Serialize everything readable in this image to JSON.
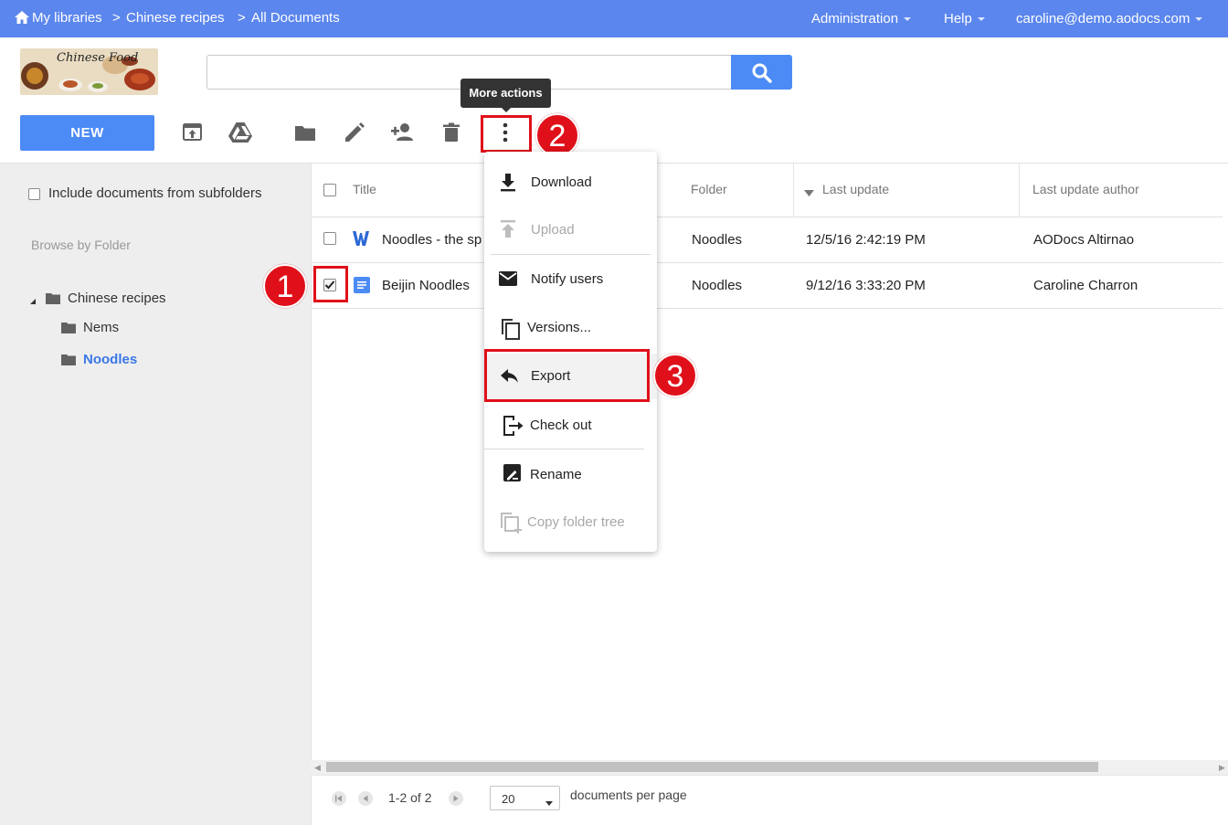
{
  "topbar": {
    "home_label": "My libraries",
    "crumb_sep": ">",
    "crumb_library": "Chinese recipes",
    "crumb_view": "All Documents",
    "admin_label": "Administration",
    "help_label": "Help",
    "user_email": "caroline@demo.aodocs.com"
  },
  "header": {
    "logo_text": "Chinese Food",
    "search_placeholder": ""
  },
  "toolbar": {
    "new_label": "NEW",
    "tooltip": "More actions"
  },
  "sidebar": {
    "include_subfolders_label": "Include documents from subfolders",
    "browse_label": "Browse by Folder",
    "tree_root": "Chinese recipes",
    "tree_children": [
      "Nems",
      "Noodles"
    ]
  },
  "table": {
    "headers": {
      "title": "Title",
      "folder": "Folder",
      "last_update": "Last update",
      "last_update_author": "Last update author"
    },
    "rows": [
      {
        "title": "Noodles - the sp",
        "folder": "Noodles",
        "last_update": "12/5/16 2:42:19 PM",
        "author": "AODocs Altirnao",
        "checked": false,
        "type": "word-doc"
      },
      {
        "title": "Beijin Noodles",
        "folder": "Noodles",
        "last_update": "9/12/16 3:33:20 PM",
        "author": "Caroline Charron",
        "checked": true,
        "type": "google-doc"
      }
    ]
  },
  "menu": {
    "items": [
      {
        "label": "Download",
        "icon": "download-icon",
        "disabled": false
      },
      {
        "label": "Upload",
        "icon": "upload-icon",
        "disabled": true
      },
      {
        "label": "Notify users",
        "icon": "mail-icon",
        "disabled": false
      },
      {
        "label": "Versions...",
        "icon": "versions-icon",
        "disabled": false
      },
      {
        "label": "Export",
        "icon": "reply-icon",
        "disabled": false
      },
      {
        "label": "Check out",
        "icon": "checkout-icon",
        "disabled": false
      },
      {
        "label": "Rename",
        "icon": "rename-icon",
        "disabled": false
      },
      {
        "label": "Copy folder tree",
        "icon": "copy-tree-icon",
        "disabled": true
      }
    ]
  },
  "annotations": {
    "step1": "1",
    "step2": "2",
    "step3": "3"
  },
  "pagination": {
    "range": "1-2 of 2",
    "page_size": "20",
    "per_page_label": "documents per page"
  },
  "colors": {
    "brand": "#5b86ed",
    "accent": "#4c8bf5",
    "highlight": "#e0101a",
    "sidebar_bg": "#eeeeee"
  }
}
